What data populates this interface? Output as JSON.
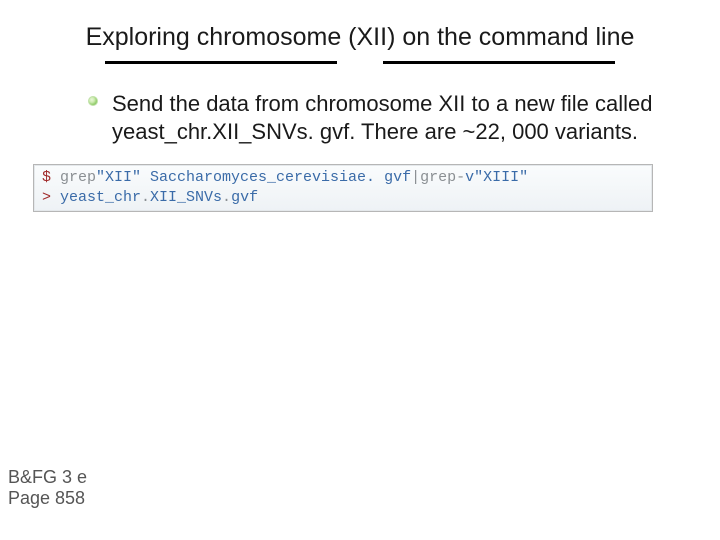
{
  "title": "Exploring  chromosome (XII) on the command line",
  "body": "Send the data from chromosome XII to a new file called yeast_chr.XII_SNVs. gvf. There are ~22, 000 variants.",
  "terminal": {
    "prompt1": "$",
    "cmd1a": "grep ",
    "cmd1b": "\"XII\" Saccharomyces_cerevisiae. gvf ",
    "cmd1c": "| ",
    "cmd1d": "grep ",
    "cmd1e": "-",
    "cmd1f": "v ",
    "cmd1g": "\"XIII\"",
    "prompt2": ">",
    "cmd2a": "yeast_chr",
    "cmd2b": ".",
    "cmd2c": "XII_SNVs",
    "cmd2d": ".",
    "cmd2e": "gvf"
  },
  "footnote": {
    "line1": "B&FG 3 e",
    "line2": "Page 858"
  }
}
